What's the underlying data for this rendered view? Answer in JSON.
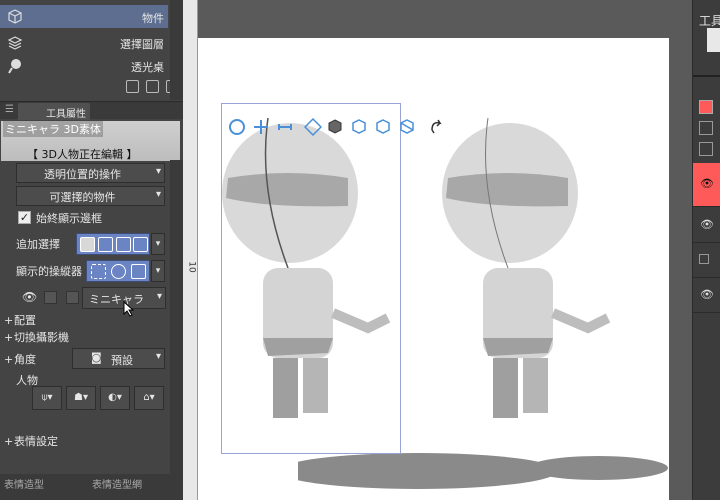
{
  "subtools": [
    {
      "label": "物件",
      "icon": "object-cube-icon",
      "selected": true
    },
    {
      "label": "選擇圖層",
      "icon": "layer-select-icon",
      "selected": false
    },
    {
      "label": "透光桌",
      "icon": "light-table-icon",
      "selected": false
    }
  ],
  "tool_property": {
    "tab_label": "工具屬性",
    "material_name": "ミニキャラ 3D素体",
    "editing_status": "【 3D人物正在編輯 】",
    "transparent_position_op": "透明位置的操作",
    "selectable_objects": "可選擇的物件",
    "always_show_border_label": "始終顯示邊框",
    "always_show_border_checked": true,
    "add_selection_label": "追加選擇",
    "displayed_manipulator_label": "顯示的操縱器",
    "layer_object_name": "ミニキャラ"
  },
  "sections": {
    "placement": "配置",
    "switch_camera": "切換攝影機",
    "angle": "角度",
    "angle_preset": "預設",
    "person": "人物",
    "expression": "表情設定"
  },
  "bottom_tabs": [
    "表情造型",
    "表情造型網"
  ],
  "ruler_value": "10",
  "right_panel": {
    "tool_label": "工具",
    "accent_color": "#ff5a5a"
  },
  "colors": {
    "selected_subtool": "#5d6e90",
    "button_group": "#6b84c4",
    "bounding_box": "#9aa3d6"
  }
}
